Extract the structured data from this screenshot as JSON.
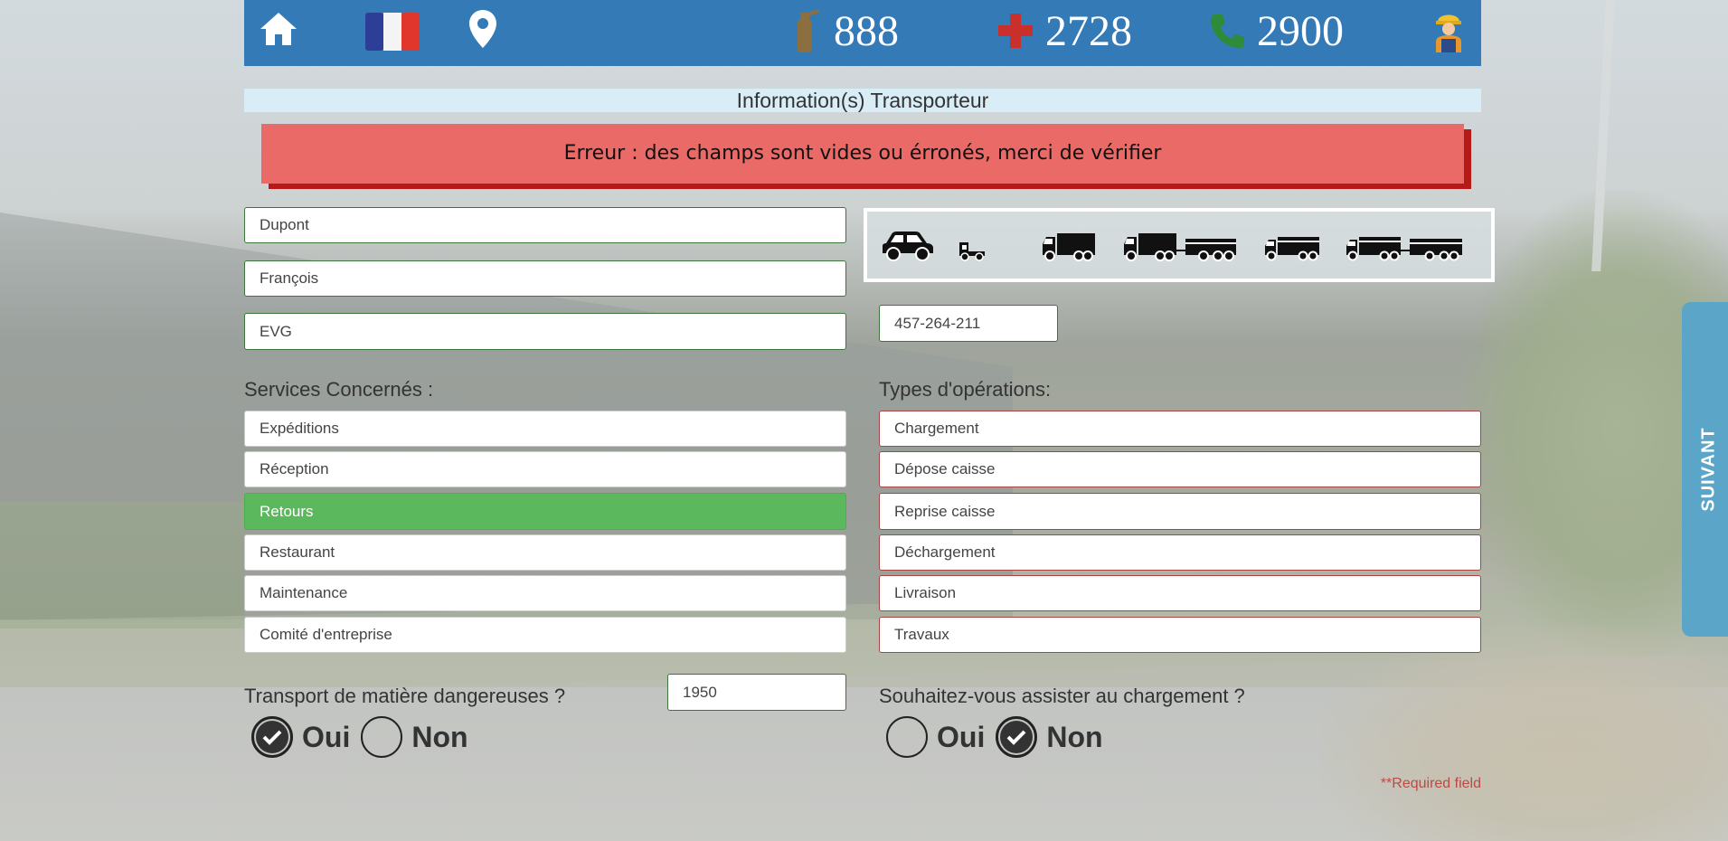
{
  "topbar": {
    "counters": [
      {
        "icon": "fire-extinguisher-icon",
        "value": "888",
        "color": "#8b6f3e"
      },
      {
        "icon": "red-cross-icon",
        "value": "2728",
        "color": "#c9302c"
      },
      {
        "icon": "phone-icon",
        "value": "2900",
        "color": "#2e8b3a"
      }
    ]
  },
  "title": "Information(s) Transporteur",
  "error": "Erreur : des champs sont vides ou érronés, merci de vérifier",
  "identity": {
    "nom": "Dupont",
    "prenom": "François",
    "societe": "EVG"
  },
  "plate": "457-264-211",
  "services": {
    "label": "Services Concernés :",
    "items": [
      {
        "label": "Expéditions",
        "selected": false
      },
      {
        "label": "Réception",
        "selected": false
      },
      {
        "label": "Retours",
        "selected": true
      },
      {
        "label": "Restaurant",
        "selected": false
      },
      {
        "label": "Maintenance",
        "selected": false
      },
      {
        "label": "Comité d'entreprise",
        "selected": false
      }
    ]
  },
  "operations": {
    "label": "Types d'opérations:",
    "items": [
      "Chargement",
      "Dépose caisse",
      "Reprise caisse",
      "Déchargement",
      "Livraison",
      "Travaux"
    ]
  },
  "dangerous": {
    "question": "Transport de matière dangereuses ?",
    "code": "1950",
    "oui": "Oui",
    "non": "Non",
    "selected": "Oui"
  },
  "assist": {
    "question": "Souhaitez-vous assister au chargement ?",
    "oui": "Oui",
    "non": "Non",
    "selected": "Non"
  },
  "required_note": "**Required field",
  "next_button": "SUIVANT",
  "colors": {
    "header": "#337ab7",
    "error_bg": "#e96a66",
    "selected_green": "#5cb85c"
  }
}
